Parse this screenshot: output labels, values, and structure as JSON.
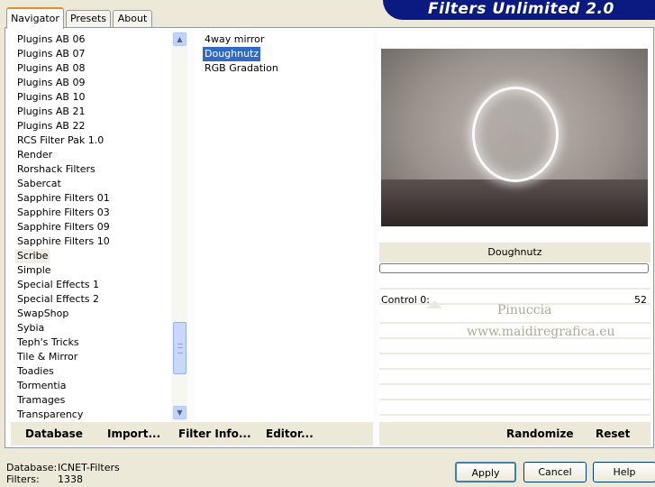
{
  "app_title": "Filters Unlimited 2.0",
  "tabs": [
    "Navigator",
    "Presets",
    "About"
  ],
  "categories": [
    "Plugins AB 06",
    "Plugins AB 07",
    "Plugins AB 08",
    "Plugins AB 09",
    "Plugins AB 10",
    "Plugins AB 21",
    "Plugins AB 22",
    "RCS Filter Pak 1.0",
    "Render",
    "Rorshack Filters",
    "Sabercat",
    "Sapphire Filters 01",
    "Sapphire Filters 03",
    "Sapphire Filters 09",
    "Sapphire Filters 10",
    "Scribe",
    "Simple",
    "Special Effects 1",
    "Special Effects 2",
    "SwapShop",
    "Sybia",
    "Teph's Tricks",
    "Tile & Mirror",
    "Toadies",
    "Tormentia",
    "Tramages",
    "Transparency"
  ],
  "selected_category": "Scribe",
  "filters": [
    "4way mirror",
    "Doughnutz",
    "RGB Gradation"
  ],
  "selected_filter": "Doughnutz",
  "filter_title": "Doughnutz",
  "controls": [
    {
      "label": "Control 0:",
      "value": "52"
    }
  ],
  "watermark": [
    "Pinuccia",
    "www.maidiregrafica.eu"
  ],
  "toolbar_left": [
    "Database",
    "Import...",
    "Filter Info...",
    "Editor..."
  ],
  "toolbar_right": [
    "Randomize",
    "Reset"
  ],
  "status": {
    "database_label": "Database:",
    "database_value": "ICNET-Filters",
    "filters_label": "Filters:",
    "filters_value": "1338"
  },
  "dialog_buttons": [
    "Apply",
    "Cancel",
    "Help"
  ],
  "colors": {
    "banner": "#0a1a80",
    "selection": "#316ac5",
    "tab_accent": "#e68b2c"
  }
}
